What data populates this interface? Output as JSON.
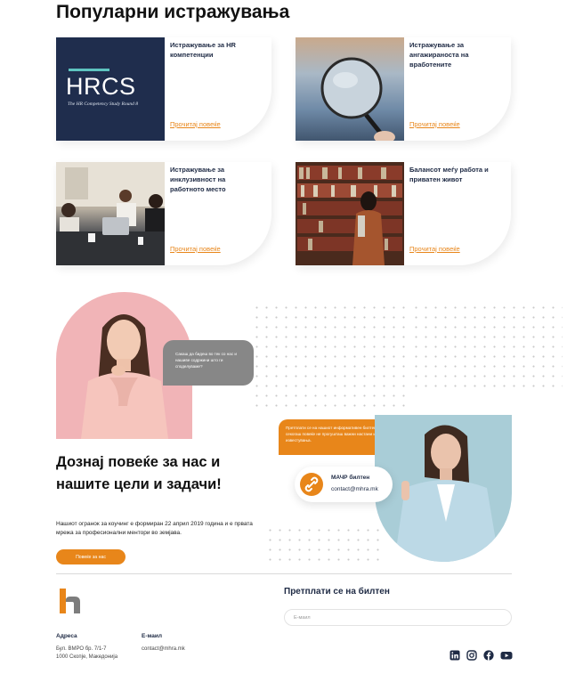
{
  "research": {
    "title": "Популарни истражувања",
    "cards": [
      {
        "title": "Истражување за HR компетенции",
        "link": "Прочитај повеќе",
        "logo_text": "HRCS",
        "logo_subtitle": "The HR Competency Study Round 8"
      },
      {
        "title": "Истражување за ангажираноста на вработените",
        "link": "Прочитај повеќе"
      },
      {
        "title": "Истражување за инклузивност на работното место",
        "link": "Прочитај повеќе"
      },
      {
        "title": "Балансот меѓу работа и приватен живот",
        "link": "Прочитај повеќе"
      }
    ]
  },
  "about": {
    "gray_bubble": "Сакаш да бидеш во тек со нас и нашиве содржини што ги споделуваме?",
    "orange_bubble": "Претплати се на нашиот информативен билтен и секогаш повеќе не прогушташ важни настани и известувања.",
    "contact_name": "МАЧР билтен",
    "contact_email": "contact@mhra.mk",
    "title_line1": "Дознај повеќе за нас и",
    "title_line2": "нашите цели и задачи!",
    "text": "Нашиот огранок за коучинг е формиран 22 април 2019 година и е првата мрежа за професионални ментори во земјава.",
    "button": "Повеќе за нас"
  },
  "footer": {
    "address_label": "Адреса",
    "address_line1": "Бул. ВМРО бр. 7/1-7",
    "address_line2": "1000 Скопје, Македонија",
    "email_label": "Е-маил",
    "email": "contact@mhra.mk",
    "newsletter_title": "Претплати се на билтен",
    "email_placeholder": "Е-маил",
    "social_icons": [
      "linkedin-icon",
      "instagram-icon",
      "facebook-icon",
      "youtube-icon"
    ]
  },
  "colors": {
    "accent": "#e8861a",
    "navy": "#1e2a44",
    "gray_bubble": "#878787"
  }
}
